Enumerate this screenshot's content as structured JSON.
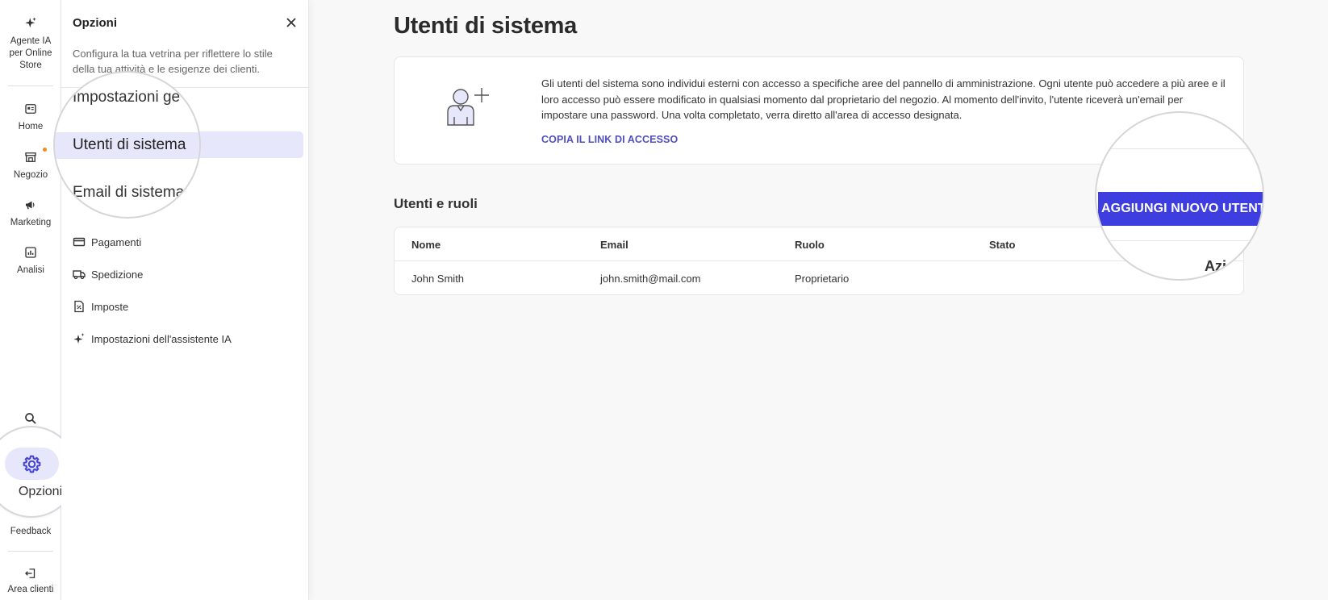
{
  "rail": {
    "ai_agent_label": "Agente IA per Online Store",
    "items": [
      {
        "label": "Home",
        "icon": "home-icon"
      },
      {
        "label": "Negozio",
        "icon": "store-icon"
      },
      {
        "label": "Marketing",
        "icon": "megaphone-icon"
      },
      {
        "label": "Analisi",
        "icon": "chart-icon"
      }
    ],
    "options_label": "Opzioni",
    "feedback_label": "Feedback",
    "client_area_label": "Area clienti",
    "accent_color": "#4545d6",
    "notification_color": "#f08a24"
  },
  "panel": {
    "title": "Opzioni",
    "description": "Configura la tua vetrina per riflettere lo stile della tua attività e le esigenze dei clienti.",
    "menu": {
      "general": "Impostazioni ge",
      "system_users": "Utenti di sistema",
      "system_email": "Email di sistema",
      "payments": "Pagamenti",
      "shipping": "Spedizione",
      "taxes": "Imposte",
      "ai_assistant": "Impostazioni dell'assistente IA"
    }
  },
  "main": {
    "title": "Utenti di sistema",
    "info_text": "Gli utenti del sistema sono individui esterni con accesso a specifiche aree del pannello di amministrazione. Ogni utente può accedere a più aree e il loro accesso può essere modificato in qualsiasi momento dal proprietario del negozio. Al momento dell'invito, l'utente riceverà un'email per impostare una password. Una volta completato, verra diretto all'area di accesso designata.",
    "copy_link": "COPIA IL LINK DI ACCESSO",
    "section_title": "Utenti e ruoli",
    "add_user_button": "AGGIUNGI NUOVO UTENTE",
    "actions_header_partial": "Azi",
    "table": {
      "headers": [
        "Nome",
        "Email",
        "Ruolo",
        "Stato"
      ],
      "rows": [
        {
          "name": "John Smith",
          "email": "john.smith@mail.com",
          "role": "Proprietario",
          "status": ""
        }
      ]
    }
  }
}
